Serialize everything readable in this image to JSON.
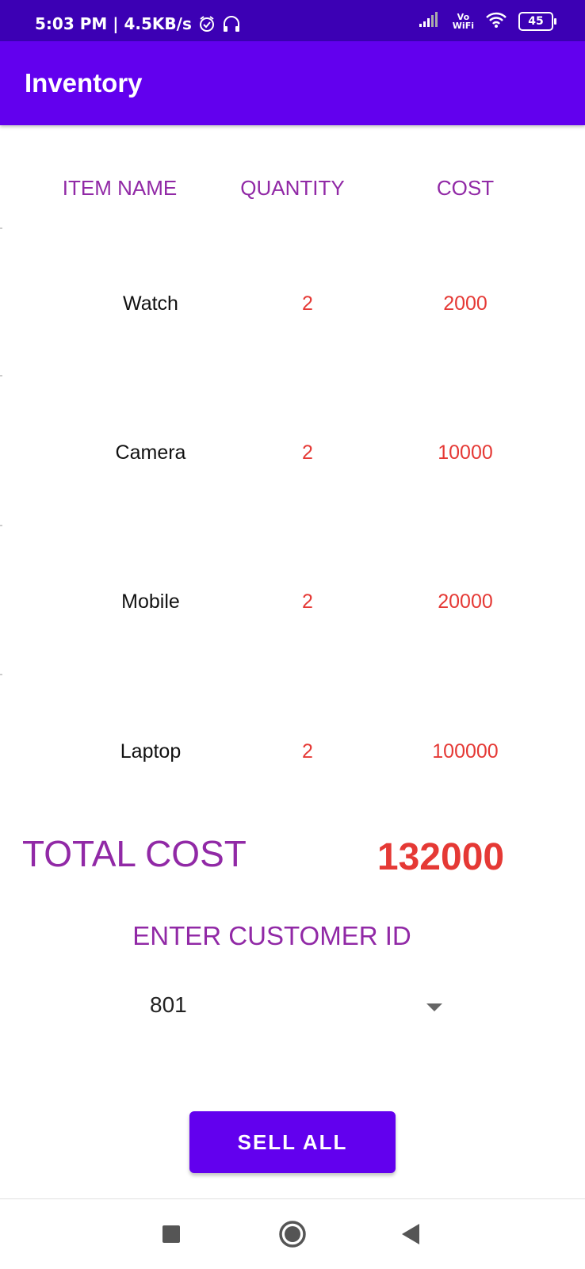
{
  "status_bar": {
    "time_speed": "5:03 PM | 4.5KB/s",
    "network_label_top": "Vo",
    "network_label_bottom": "WiFi",
    "battery_level": "45",
    "icons": [
      "alarm-icon",
      "headset-icon",
      "signal-icon",
      "wifi-icon",
      "battery-icon"
    ]
  },
  "app_bar": {
    "title": "Inventory"
  },
  "table": {
    "headers": {
      "name": "ITEM NAME",
      "quantity": "QUANTITY",
      "cost": "COST"
    },
    "rows": [
      {
        "name": "Watch",
        "quantity": "2",
        "cost": "2000"
      },
      {
        "name": "Camera",
        "quantity": "2",
        "cost": "10000"
      },
      {
        "name": "Mobile",
        "quantity": "2",
        "cost": "20000"
      },
      {
        "name": "Laptop",
        "quantity": "2",
        "cost": "100000"
      }
    ]
  },
  "total": {
    "label": "TOTAL COST",
    "value": "132000"
  },
  "customer": {
    "label": "ENTER CUSTOMER ID",
    "selected_id": "801"
  },
  "actions": {
    "sell_all": "SELL ALL"
  },
  "nav_bar": {
    "icons": [
      "square-recents-icon",
      "circle-home-icon",
      "triangle-back-icon"
    ]
  },
  "colors": {
    "status_bar": "#3c00b4",
    "app_bar": "#6200ee",
    "header_text": "#9129a6",
    "value_text": "#e53935",
    "button": "#6200ee"
  }
}
